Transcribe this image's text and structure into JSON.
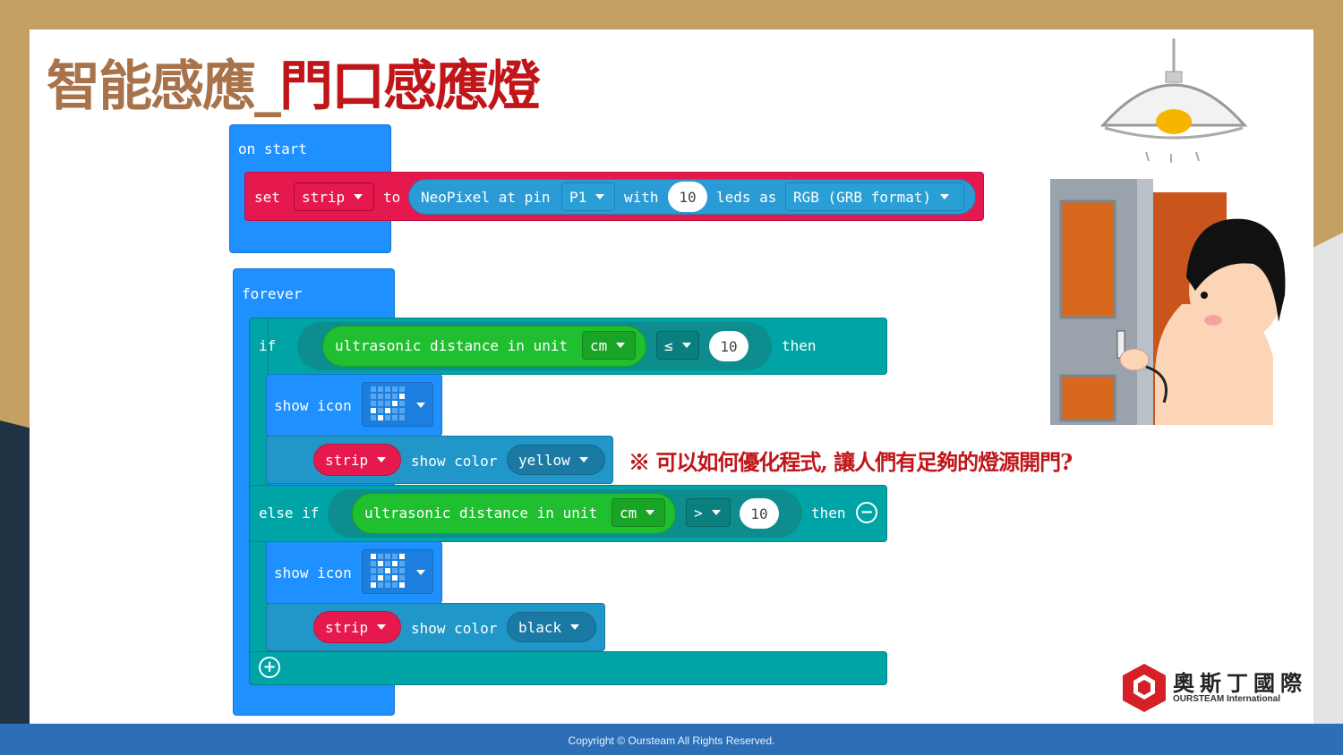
{
  "slide": {
    "title_part1": "智能感應_",
    "title_part2": "門口感應燈",
    "note": "※ 可以如何優化程式, 讓人們有足夠的燈源開門?",
    "footer": "Copyright © Oursteam All Rights Reserved."
  },
  "on_start": {
    "hat_label": "on start",
    "set_label": "set",
    "variable": "strip",
    "to_label": "to",
    "neopixel_label": "NeoPixel at pin",
    "pin": "P1",
    "with_label": "with",
    "led_count": "10",
    "leds_as_label": "leds as",
    "format": "RGB (GRB format)"
  },
  "forever": {
    "hat_label": "forever",
    "if_label": "if",
    "sensor1": "ultrasonic distance in unit",
    "unit1": "cm",
    "op1": "≤",
    "value1": "10",
    "then1": "then",
    "show_icon1": "show icon",
    "strip1": "strip",
    "show_color1": "show color",
    "color1": "yellow",
    "else_if_label": "else if",
    "sensor2": "ultrasonic distance in unit",
    "unit2": "cm",
    "op2": ">",
    "value2": "10",
    "then2": "then",
    "show_icon2": "show icon",
    "strip2": "strip",
    "show_color2": "show color",
    "color2": "black"
  },
  "logo": {
    "name": "奧斯丁國際",
    "sub": "OURSTEAM International"
  },
  "icons": {
    "check_pattern": [
      0,
      0,
      0,
      0,
      0,
      0,
      0,
      0,
      0,
      1,
      0,
      0,
      0,
      1,
      0,
      1,
      0,
      1,
      0,
      0,
      0,
      1,
      0,
      0,
      0
    ],
    "x_pattern": [
      1,
      0,
      0,
      0,
      1,
      0,
      1,
      0,
      1,
      0,
      0,
      0,
      1,
      0,
      0,
      0,
      1,
      0,
      1,
      0,
      1,
      0,
      0,
      0,
      1
    ],
    "remove_icon": "minus-circle-icon",
    "add_icon": "plus-circle-icon"
  },
  "colors": {
    "accent_red": "#c0161a",
    "title_brown": "#a8734a",
    "footer_blue": "#2d6fb7",
    "hat_blue": "#1e90ff",
    "set_red": "#e6194e",
    "logic_teal": "#00a4a6",
    "sensor_green": "#20bf30"
  }
}
